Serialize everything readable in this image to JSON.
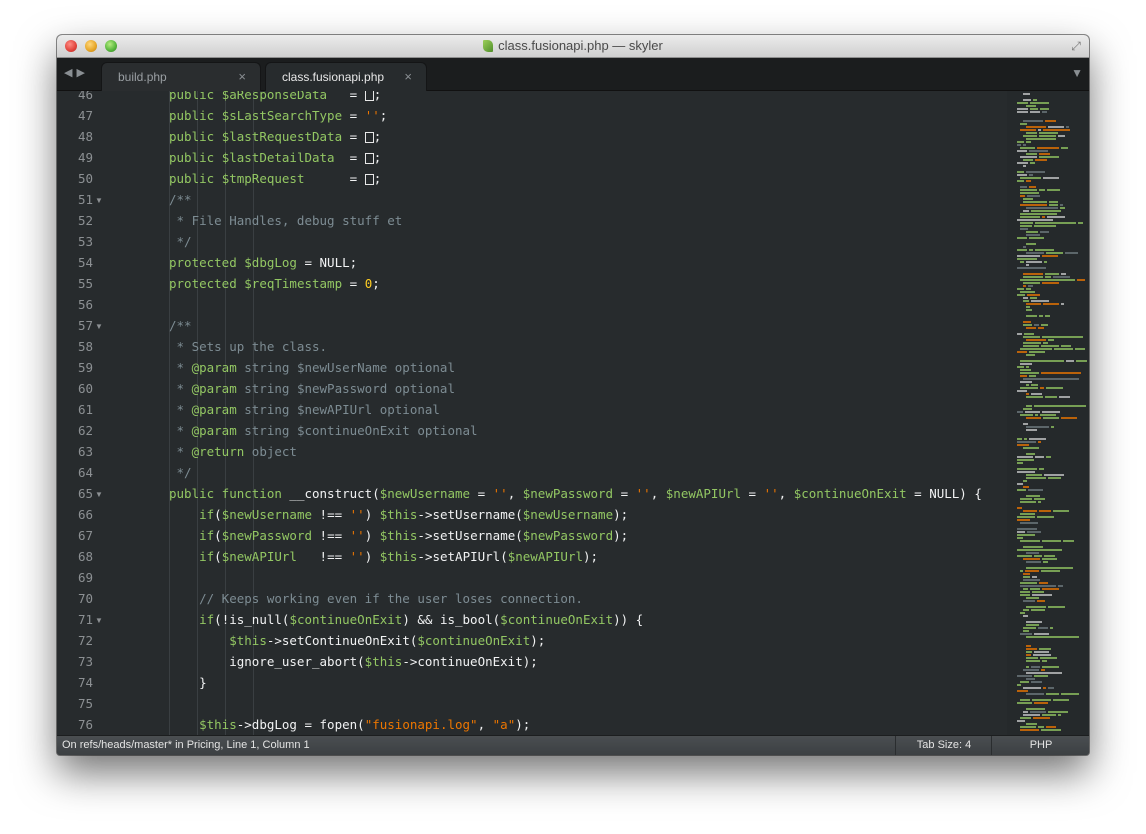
{
  "window": {
    "title": "class.fusionapi.php — skyler"
  },
  "tabs": [
    {
      "label": "build.php",
      "active": false
    },
    {
      "label": "class.fusionapi.php",
      "active": true
    }
  ],
  "editor": {
    "lines": [
      {
        "n": "46",
        "fold": false,
        "segs": [
          [
            "kw",
            "public "
          ],
          [
            "var",
            "$aResponseData"
          ],
          [
            "pl",
            "   = "
          ],
          [
            "br",
            ""
          ],
          [
            "pl",
            ";"
          ]
        ]
      },
      {
        "n": "47",
        "fold": false,
        "segs": [
          [
            "kw",
            "public "
          ],
          [
            "var",
            "$sLastSearchType"
          ],
          [
            "pl",
            " = "
          ],
          [
            "str",
            "''"
          ],
          [
            "pl",
            ";"
          ]
        ]
      },
      {
        "n": "48",
        "fold": false,
        "segs": [
          [
            "kw",
            "public "
          ],
          [
            "var",
            "$lastRequestData"
          ],
          [
            "pl",
            " = "
          ],
          [
            "br",
            ""
          ],
          [
            "pl",
            ";"
          ]
        ]
      },
      {
        "n": "49",
        "fold": false,
        "segs": [
          [
            "kw",
            "public "
          ],
          [
            "var",
            "$lastDetailData"
          ],
          [
            "pl",
            "  = "
          ],
          [
            "br",
            ""
          ],
          [
            "pl",
            ";"
          ]
        ]
      },
      {
        "n": "50",
        "fold": false,
        "segs": [
          [
            "kw",
            "public "
          ],
          [
            "var",
            "$tmpRequest"
          ],
          [
            "pl",
            "      = "
          ],
          [
            "br",
            ""
          ],
          [
            "pl",
            ";"
          ]
        ]
      },
      {
        "n": "51",
        "fold": true,
        "segs": [
          [
            "com",
            "/**"
          ]
        ]
      },
      {
        "n": "52",
        "fold": false,
        "segs": [
          [
            "com",
            " * File Handles, debug stuff et"
          ]
        ]
      },
      {
        "n": "53",
        "fold": false,
        "segs": [
          [
            "com",
            " */"
          ]
        ]
      },
      {
        "n": "54",
        "fold": false,
        "segs": [
          [
            "kw",
            "protected "
          ],
          [
            "var",
            "$dbgLog"
          ],
          [
            "pl",
            " = NULL;"
          ]
        ]
      },
      {
        "n": "55",
        "fold": false,
        "segs": [
          [
            "kw",
            "protected "
          ],
          [
            "var",
            "$reqTimestamp"
          ],
          [
            "pl",
            " = "
          ],
          [
            "num",
            "0"
          ],
          [
            "pl",
            ";"
          ]
        ]
      },
      {
        "n": "56",
        "fold": false,
        "segs": []
      },
      {
        "n": "57",
        "fold": true,
        "segs": [
          [
            "com",
            "/**"
          ]
        ]
      },
      {
        "n": "58",
        "fold": false,
        "segs": [
          [
            "com",
            " * Sets up the class."
          ]
        ]
      },
      {
        "n": "59",
        "fold": false,
        "segs": [
          [
            "com",
            " * "
          ],
          [
            "doc",
            "@param"
          ],
          [
            "com",
            " string $newUserName optional"
          ]
        ]
      },
      {
        "n": "60",
        "fold": false,
        "segs": [
          [
            "com",
            " * "
          ],
          [
            "doc",
            "@param"
          ],
          [
            "com",
            " string $newPassword optional"
          ]
        ]
      },
      {
        "n": "61",
        "fold": false,
        "segs": [
          [
            "com",
            " * "
          ],
          [
            "doc",
            "@param"
          ],
          [
            "com",
            " string $newAPIUrl optional"
          ]
        ]
      },
      {
        "n": "62",
        "fold": false,
        "segs": [
          [
            "com",
            " * "
          ],
          [
            "doc",
            "@param"
          ],
          [
            "com",
            " string $continueOnExit optional"
          ]
        ]
      },
      {
        "n": "63",
        "fold": false,
        "segs": [
          [
            "com",
            " * "
          ],
          [
            "doc",
            "@return"
          ],
          [
            "com",
            " object"
          ]
        ]
      },
      {
        "n": "64",
        "fold": false,
        "segs": [
          [
            "com",
            " */"
          ]
        ]
      },
      {
        "n": "65",
        "fold": true,
        "segs": [
          [
            "kw",
            "public function "
          ],
          [
            "pl",
            "__construct("
          ],
          [
            "var",
            "$newUsername"
          ],
          [
            "pl",
            " = "
          ],
          [
            "str",
            "''"
          ],
          [
            "pl",
            ", "
          ],
          [
            "var",
            "$newPassword"
          ],
          [
            "pl",
            " = "
          ],
          [
            "str",
            "''"
          ],
          [
            "pl",
            ", "
          ],
          [
            "var",
            "$newAPIUrl"
          ],
          [
            "pl",
            " = "
          ],
          [
            "str",
            "''"
          ],
          [
            "pl",
            ", "
          ],
          [
            "var",
            "$continueOnExit"
          ],
          [
            "pl",
            " = NULL) {"
          ]
        ]
      },
      {
        "n": "66",
        "fold": false,
        "segs": [
          [
            "pl",
            "    "
          ],
          [
            "kw",
            "if"
          ],
          [
            "pl",
            "("
          ],
          [
            "var",
            "$newUsername"
          ],
          [
            "pl",
            " !== "
          ],
          [
            "str",
            "''"
          ],
          [
            "pl",
            ") "
          ],
          [
            "var",
            "$this"
          ],
          [
            "pl",
            "->setUsername("
          ],
          [
            "var",
            "$newUsername"
          ],
          [
            "pl",
            ");"
          ]
        ]
      },
      {
        "n": "67",
        "fold": false,
        "segs": [
          [
            "pl",
            "    "
          ],
          [
            "kw",
            "if"
          ],
          [
            "pl",
            "("
          ],
          [
            "var",
            "$newPassword"
          ],
          [
            "pl",
            " !== "
          ],
          [
            "str",
            "''"
          ],
          [
            "pl",
            ") "
          ],
          [
            "var",
            "$this"
          ],
          [
            "pl",
            "->setUsername("
          ],
          [
            "var",
            "$newPassword"
          ],
          [
            "pl",
            ");"
          ]
        ]
      },
      {
        "n": "68",
        "fold": false,
        "segs": [
          [
            "pl",
            "    "
          ],
          [
            "kw",
            "if"
          ],
          [
            "pl",
            "("
          ],
          [
            "var",
            "$newAPIUrl"
          ],
          [
            "pl",
            "   !== "
          ],
          [
            "str",
            "''"
          ],
          [
            "pl",
            ") "
          ],
          [
            "var",
            "$this"
          ],
          [
            "pl",
            "->setAPIUrl("
          ],
          [
            "var",
            "$newAPIUrl"
          ],
          [
            "pl",
            ");"
          ]
        ]
      },
      {
        "n": "69",
        "fold": false,
        "segs": []
      },
      {
        "n": "70",
        "fold": false,
        "segs": [
          [
            "pl",
            "    "
          ],
          [
            "com",
            "// Keeps working even if the user loses connection."
          ]
        ]
      },
      {
        "n": "71",
        "fold": true,
        "segs": [
          [
            "pl",
            "    "
          ],
          [
            "kw",
            "if"
          ],
          [
            "pl",
            "(!is_null("
          ],
          [
            "var",
            "$continueOnExit"
          ],
          [
            "pl",
            ") && is_bool("
          ],
          [
            "var",
            "$continueOnExit"
          ],
          [
            "pl",
            ")) {"
          ]
        ]
      },
      {
        "n": "72",
        "fold": false,
        "segs": [
          [
            "pl",
            "        "
          ],
          [
            "var",
            "$this"
          ],
          [
            "pl",
            "->setContinueOnExit("
          ],
          [
            "var",
            "$continueOnExit"
          ],
          [
            "pl",
            ");"
          ]
        ]
      },
      {
        "n": "73",
        "fold": false,
        "segs": [
          [
            "pl",
            "        ignore_user_abort("
          ],
          [
            "var",
            "$this"
          ],
          [
            "pl",
            "->continueOnExit);"
          ]
        ]
      },
      {
        "n": "74",
        "fold": false,
        "segs": [
          [
            "pl",
            "    }"
          ]
        ]
      },
      {
        "n": "75",
        "fold": false,
        "segs": []
      },
      {
        "n": "76",
        "fold": false,
        "segs": [
          [
            "pl",
            "    "
          ],
          [
            "var",
            "$this"
          ],
          [
            "pl",
            "->dbgLog = fopen("
          ],
          [
            "str",
            "\"fusionapi.log\""
          ],
          [
            "pl",
            ", "
          ],
          [
            "str",
            "\"a\""
          ],
          [
            "pl",
            ");"
          ]
        ]
      }
    ]
  },
  "statusbar": {
    "position": "On refs/heads/master* in Pricing, Line 1, Column 1",
    "tab_size": "Tab Size: 4",
    "syntax": "PHP"
  },
  "colors": {
    "background": "#272b2d",
    "keyword": "#93c763",
    "string": "#ec7600",
    "number": "#ffcd22",
    "comment": "#7d8c93"
  },
  "icons": [
    "close-icon",
    "minimize-icon",
    "maximize-icon",
    "fullscreen-icon",
    "back-arrow-icon",
    "forward-arrow-icon",
    "tab-close-icon",
    "tab-menu-icon",
    "fold-arrow-icon",
    "php-file-icon"
  ]
}
